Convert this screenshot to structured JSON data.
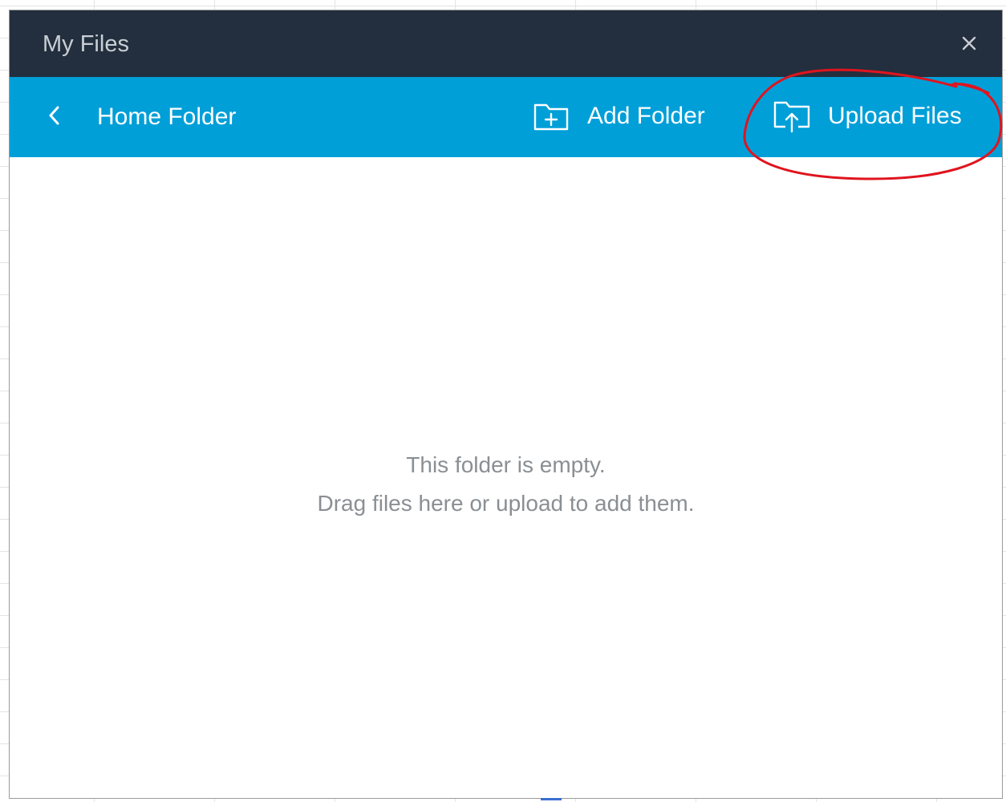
{
  "window": {
    "title": "My Files",
    "close_icon": "close-icon"
  },
  "toolbar": {
    "back_icon": "chevron-left-icon",
    "folder_name": "Home Folder",
    "add_folder_label": "Add Folder",
    "add_folder_icon": "folder-plus-icon",
    "upload_files_label": "Upload Files",
    "upload_files_icon": "folder-upload-icon"
  },
  "content": {
    "empty_line1": "This folder is empty.",
    "empty_line2": "Drag files here or upload to add them."
  },
  "colors": {
    "titlebar": "#232f3e",
    "toolbar": "#009fd8",
    "annotation": "#e0141e",
    "muted_text": "#8a8f94"
  }
}
